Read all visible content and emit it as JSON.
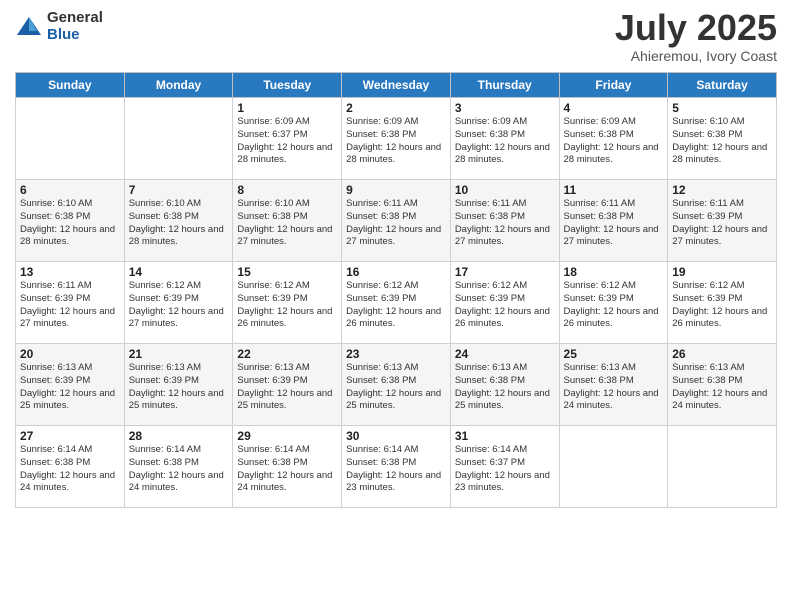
{
  "logo": {
    "general": "General",
    "blue": "Blue"
  },
  "header": {
    "month": "July 2025",
    "location": "Ahieremou, Ivory Coast"
  },
  "weekdays": [
    "Sunday",
    "Monday",
    "Tuesday",
    "Wednesday",
    "Thursday",
    "Friday",
    "Saturday"
  ],
  "weeks": [
    [
      {
        "day": "",
        "info": ""
      },
      {
        "day": "",
        "info": ""
      },
      {
        "day": "1",
        "info": "Sunrise: 6:09 AM\nSunset: 6:37 PM\nDaylight: 12 hours and 28 minutes."
      },
      {
        "day": "2",
        "info": "Sunrise: 6:09 AM\nSunset: 6:38 PM\nDaylight: 12 hours and 28 minutes."
      },
      {
        "day": "3",
        "info": "Sunrise: 6:09 AM\nSunset: 6:38 PM\nDaylight: 12 hours and 28 minutes."
      },
      {
        "day": "4",
        "info": "Sunrise: 6:09 AM\nSunset: 6:38 PM\nDaylight: 12 hours and 28 minutes."
      },
      {
        "day": "5",
        "info": "Sunrise: 6:10 AM\nSunset: 6:38 PM\nDaylight: 12 hours and 28 minutes."
      }
    ],
    [
      {
        "day": "6",
        "info": "Sunrise: 6:10 AM\nSunset: 6:38 PM\nDaylight: 12 hours and 28 minutes."
      },
      {
        "day": "7",
        "info": "Sunrise: 6:10 AM\nSunset: 6:38 PM\nDaylight: 12 hours and 28 minutes."
      },
      {
        "day": "8",
        "info": "Sunrise: 6:10 AM\nSunset: 6:38 PM\nDaylight: 12 hours and 27 minutes."
      },
      {
        "day": "9",
        "info": "Sunrise: 6:11 AM\nSunset: 6:38 PM\nDaylight: 12 hours and 27 minutes."
      },
      {
        "day": "10",
        "info": "Sunrise: 6:11 AM\nSunset: 6:38 PM\nDaylight: 12 hours and 27 minutes."
      },
      {
        "day": "11",
        "info": "Sunrise: 6:11 AM\nSunset: 6:38 PM\nDaylight: 12 hours and 27 minutes."
      },
      {
        "day": "12",
        "info": "Sunrise: 6:11 AM\nSunset: 6:39 PM\nDaylight: 12 hours and 27 minutes."
      }
    ],
    [
      {
        "day": "13",
        "info": "Sunrise: 6:11 AM\nSunset: 6:39 PM\nDaylight: 12 hours and 27 minutes."
      },
      {
        "day": "14",
        "info": "Sunrise: 6:12 AM\nSunset: 6:39 PM\nDaylight: 12 hours and 27 minutes."
      },
      {
        "day": "15",
        "info": "Sunrise: 6:12 AM\nSunset: 6:39 PM\nDaylight: 12 hours and 26 minutes."
      },
      {
        "day": "16",
        "info": "Sunrise: 6:12 AM\nSunset: 6:39 PM\nDaylight: 12 hours and 26 minutes."
      },
      {
        "day": "17",
        "info": "Sunrise: 6:12 AM\nSunset: 6:39 PM\nDaylight: 12 hours and 26 minutes."
      },
      {
        "day": "18",
        "info": "Sunrise: 6:12 AM\nSunset: 6:39 PM\nDaylight: 12 hours and 26 minutes."
      },
      {
        "day": "19",
        "info": "Sunrise: 6:12 AM\nSunset: 6:39 PM\nDaylight: 12 hours and 26 minutes."
      }
    ],
    [
      {
        "day": "20",
        "info": "Sunrise: 6:13 AM\nSunset: 6:39 PM\nDaylight: 12 hours and 25 minutes."
      },
      {
        "day": "21",
        "info": "Sunrise: 6:13 AM\nSunset: 6:39 PM\nDaylight: 12 hours and 25 minutes."
      },
      {
        "day": "22",
        "info": "Sunrise: 6:13 AM\nSunset: 6:39 PM\nDaylight: 12 hours and 25 minutes."
      },
      {
        "day": "23",
        "info": "Sunrise: 6:13 AM\nSunset: 6:38 PM\nDaylight: 12 hours and 25 minutes."
      },
      {
        "day": "24",
        "info": "Sunrise: 6:13 AM\nSunset: 6:38 PM\nDaylight: 12 hours and 25 minutes."
      },
      {
        "day": "25",
        "info": "Sunrise: 6:13 AM\nSunset: 6:38 PM\nDaylight: 12 hours and 24 minutes."
      },
      {
        "day": "26",
        "info": "Sunrise: 6:13 AM\nSunset: 6:38 PM\nDaylight: 12 hours and 24 minutes."
      }
    ],
    [
      {
        "day": "27",
        "info": "Sunrise: 6:14 AM\nSunset: 6:38 PM\nDaylight: 12 hours and 24 minutes."
      },
      {
        "day": "28",
        "info": "Sunrise: 6:14 AM\nSunset: 6:38 PM\nDaylight: 12 hours and 24 minutes."
      },
      {
        "day": "29",
        "info": "Sunrise: 6:14 AM\nSunset: 6:38 PM\nDaylight: 12 hours and 24 minutes."
      },
      {
        "day": "30",
        "info": "Sunrise: 6:14 AM\nSunset: 6:38 PM\nDaylight: 12 hours and 23 minutes."
      },
      {
        "day": "31",
        "info": "Sunrise: 6:14 AM\nSunset: 6:37 PM\nDaylight: 12 hours and 23 minutes."
      },
      {
        "day": "",
        "info": ""
      },
      {
        "day": "",
        "info": ""
      }
    ]
  ]
}
